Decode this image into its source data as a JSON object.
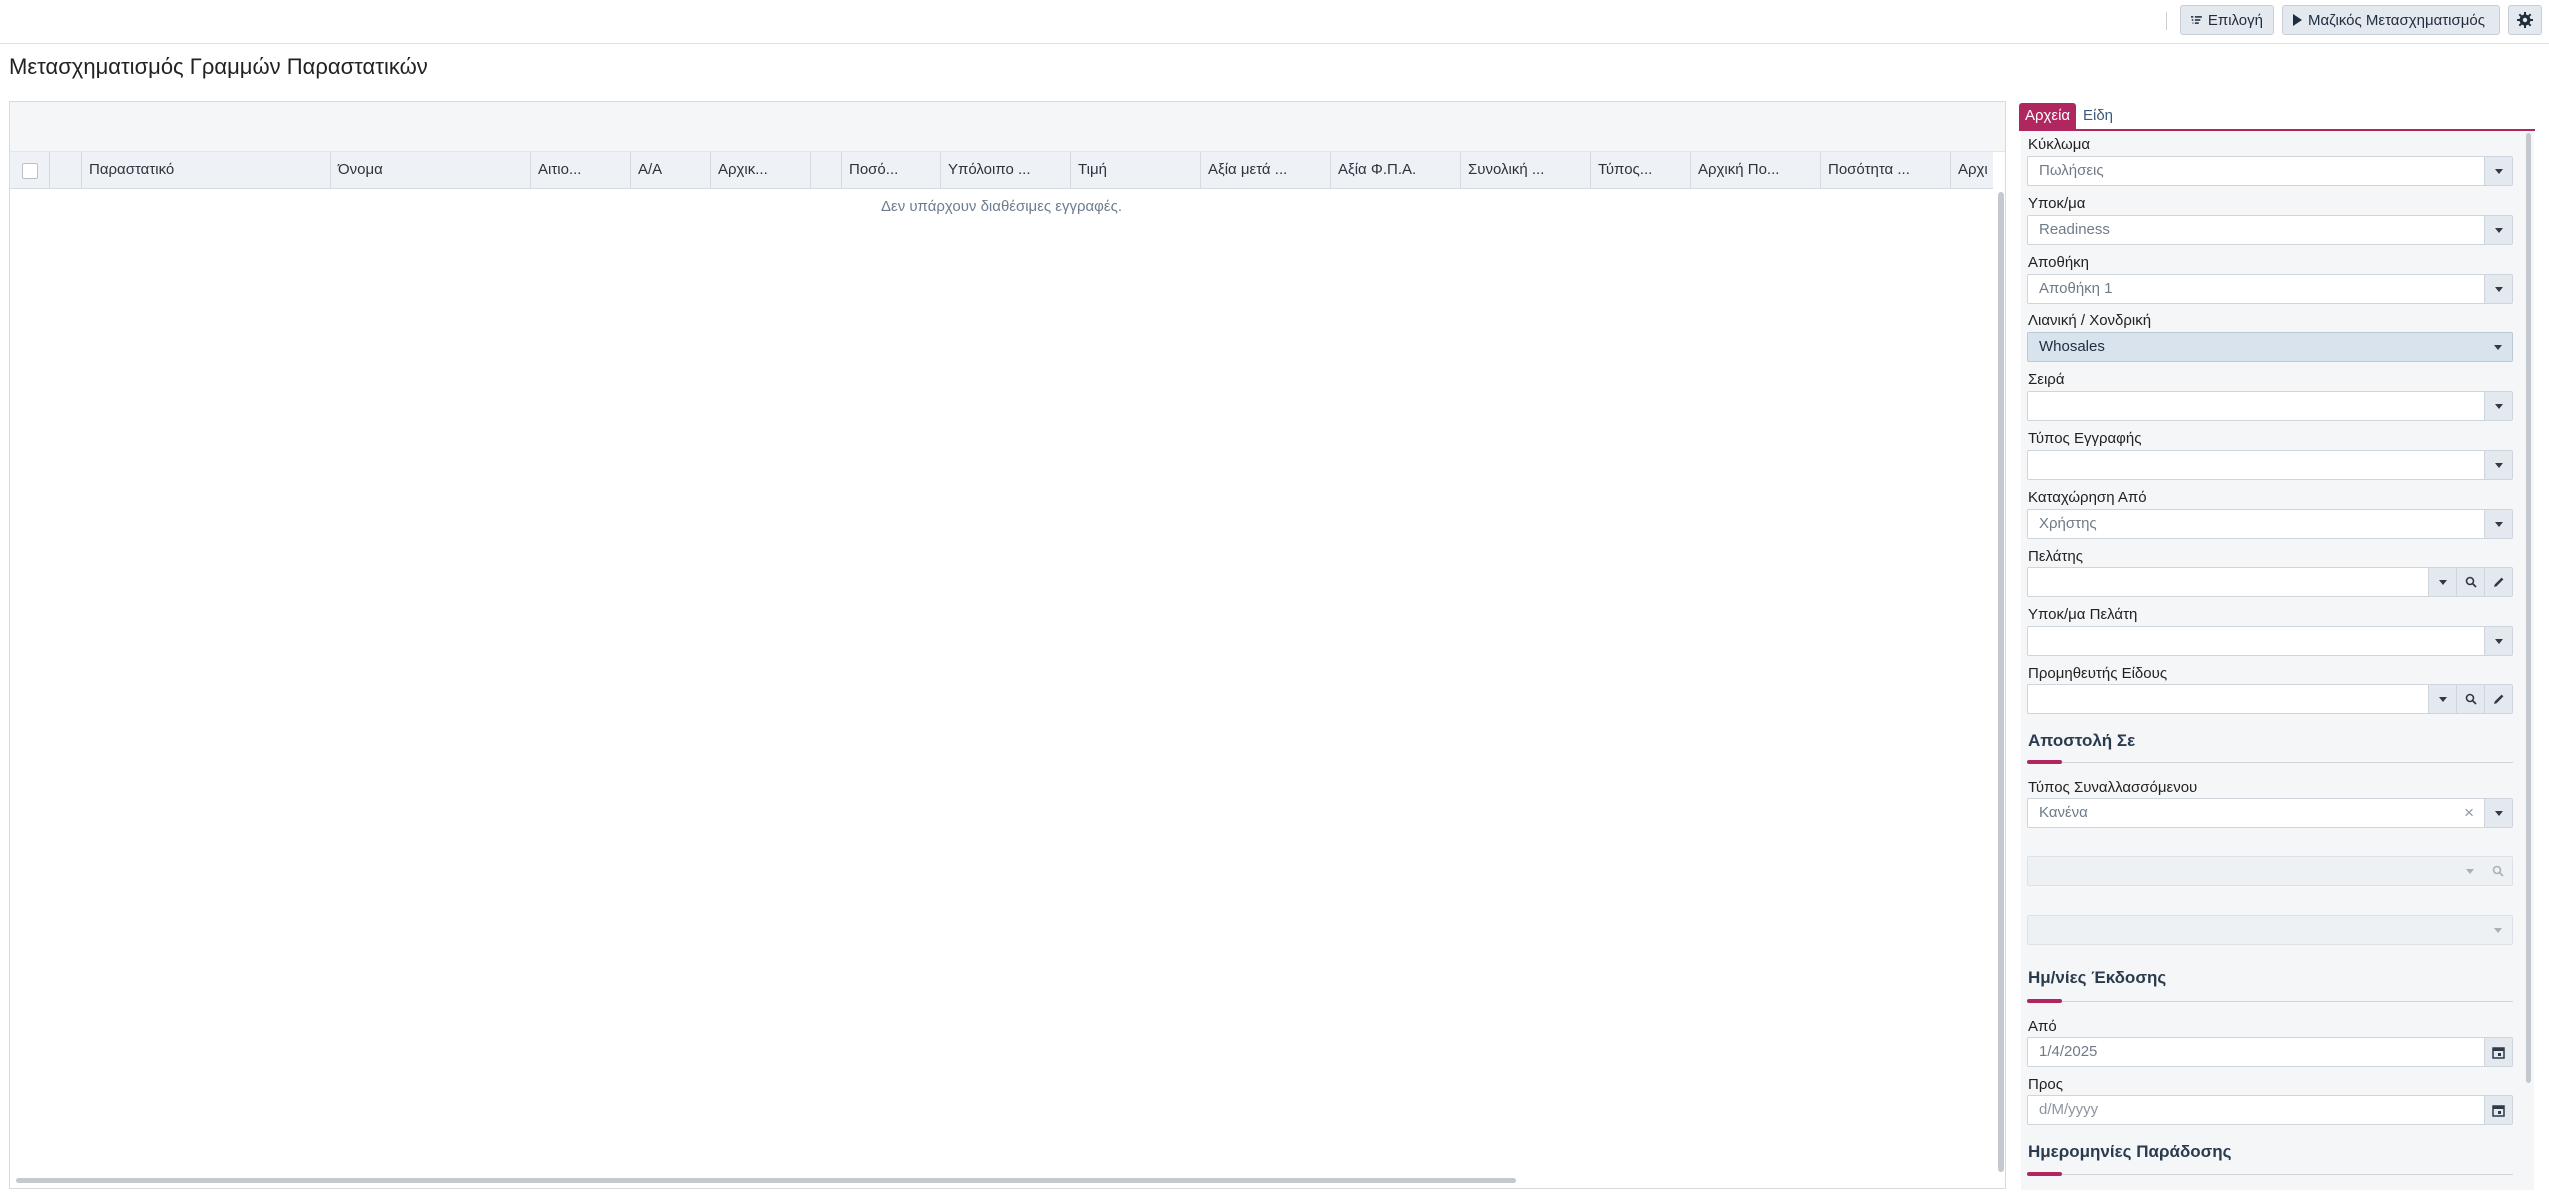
{
  "toolbar": {
    "select_label": "Επιλογή",
    "mass_transform_label": "Μαζικός Μετασχηματισμός"
  },
  "page": {
    "title": "Μετασχηματισμός Γραμμών Παραστατικών"
  },
  "grid": {
    "columns": [
      "Παραστατικό",
      "Όνομα",
      "Αιτιο...",
      "Α/Α",
      "Αρχικ...",
      "",
      "Ποσό...",
      "Υπόλοιπο ...",
      "Τιμή",
      "Αξία μετά ...",
      "Αξία Φ.Π.Α.",
      "Συνολική ...",
      "Τύπος...",
      "Αρχική Πο...",
      "Ποσότητα ...",
      "Αρχι"
    ],
    "empty_message": "Δεν υπάρχουν διαθέσιμες εγγραφές."
  },
  "filters": {
    "tabs": [
      "Αρχεία",
      "Είδη"
    ],
    "cycle": {
      "label": "Κύκλωμα",
      "value": "Πωλήσεις"
    },
    "branch": {
      "label": "Υποκ/μα",
      "value": "Readiness"
    },
    "warehouse": {
      "label": "Αποθήκη",
      "value": "Αποθήκη 1"
    },
    "retail_wholesale": {
      "label": "Λιανική / Χονδρική",
      "value": "Whosales"
    },
    "series": {
      "label": "Σειρά",
      "value": ""
    },
    "record_type": {
      "label": "Τύπος Εγγραφής",
      "value": ""
    },
    "entered_by": {
      "label": "Καταχώρηση Από",
      "value": "Χρήστης"
    },
    "customer": {
      "label": "Πελάτης",
      "value": ""
    },
    "customer_branch": {
      "label": "Υποκ/μα Πελάτη",
      "value": ""
    },
    "item_supplier": {
      "label": "Προμηθευτής Είδους",
      "value": ""
    },
    "send_to": {
      "title": "Αποστολή Σε",
      "trader_type": {
        "label": "Τύπος Συναλλασσόμενου",
        "value": "Κανένα"
      }
    },
    "issue_dates": {
      "title": "Ημ/νίες Έκδοσης",
      "from": {
        "label": "Από",
        "value": "1/4/2025"
      },
      "to": {
        "label": "Προς",
        "placeholder": "d/M/yyyy"
      }
    },
    "delivery_dates": {
      "title": "Ημερομηνίες Παράδοσης"
    }
  }
}
